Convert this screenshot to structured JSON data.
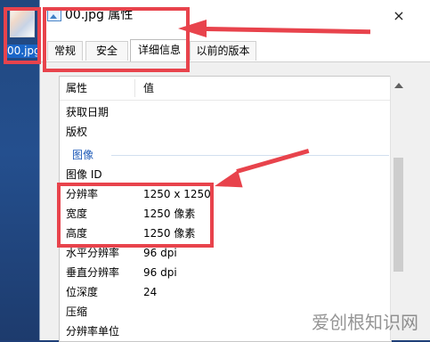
{
  "desktop": {
    "icon_label": "00.jpg"
  },
  "window": {
    "title": "00.jpg 属性",
    "close_label": "×"
  },
  "tabs": [
    {
      "label": "常规"
    },
    {
      "label": "安全"
    },
    {
      "label": "详细信息"
    },
    {
      "label": "以前的版本"
    }
  ],
  "list": {
    "headers": {
      "name": "属性",
      "value": "值"
    },
    "rows": [
      {
        "name": "获取日期",
        "value": ""
      },
      {
        "name": "版权",
        "value": ""
      }
    ],
    "section": "图像",
    "image_rows": [
      {
        "name": "图像 ID",
        "value": ""
      },
      {
        "name": "分辨率",
        "value": "1250 x 1250"
      },
      {
        "name": "宽度",
        "value": "1250 像素"
      },
      {
        "name": "高度",
        "value": "1250 像素"
      },
      {
        "name": "水平分辨率",
        "value": "96 dpi"
      },
      {
        "name": "垂直分辨率",
        "value": "96 dpi"
      },
      {
        "name": "位深度",
        "value": "24"
      },
      {
        "name": "压缩",
        "value": ""
      },
      {
        "name": "分辨率单位",
        "value": ""
      }
    ]
  },
  "annotations": {
    "color": "#e8434c"
  },
  "watermark": {
    "text": "爱创根知识网"
  }
}
